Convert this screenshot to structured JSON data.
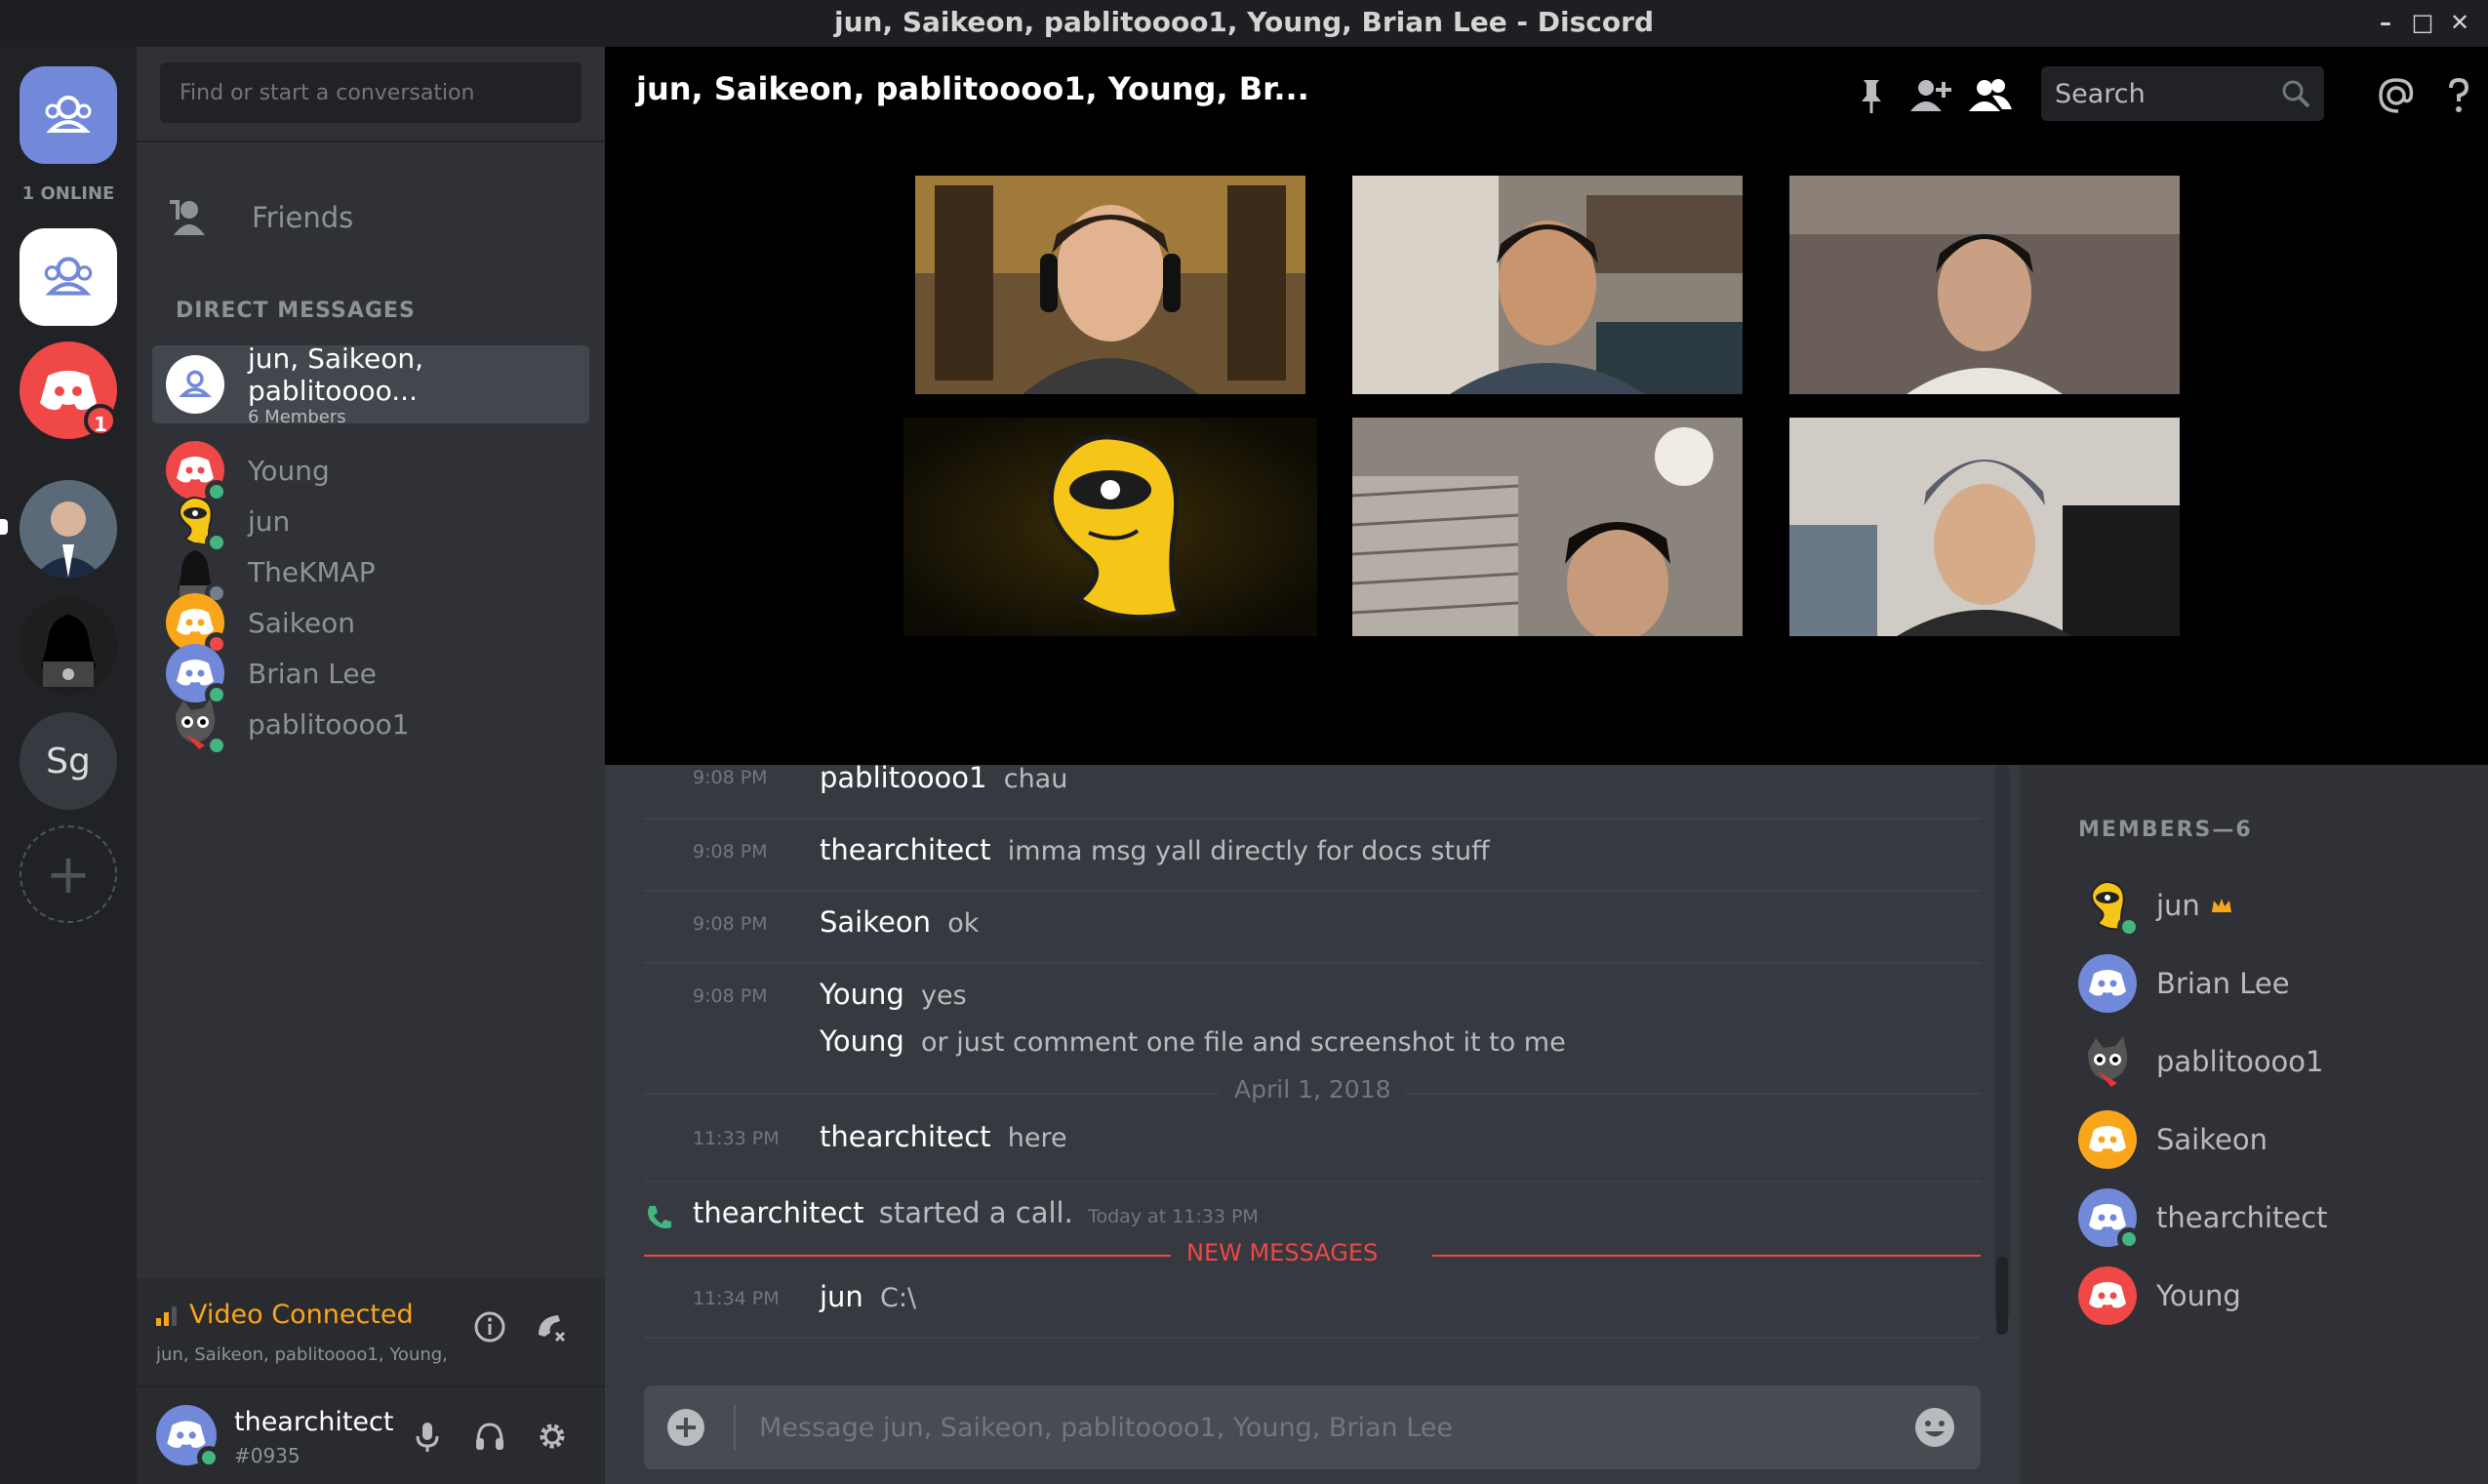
{
  "window": {
    "title": "jun, Saikeon, pablitoooo1, Young, Brian Lee - Discord"
  },
  "rail": {
    "online_label": "1 ONLINE",
    "notification_count": "1",
    "server_initials": "Sg"
  },
  "dm_sidebar": {
    "search_placeholder": "Find or start a conversation",
    "friends_label": "Friends",
    "section_header": "DIRECT MESSAGES",
    "items": [
      {
        "name": "jun, Saikeon, pablitoooo...",
        "sub": "6 Members",
        "selected": true
      },
      {
        "name": "Young",
        "status": "online"
      },
      {
        "name": "jun",
        "status": "online"
      },
      {
        "name": "TheKMAP",
        "status": "offline"
      },
      {
        "name": "Saikeon",
        "status": "dnd"
      },
      {
        "name": "Brian Lee",
        "status": "online"
      },
      {
        "name": "pablitoooo1",
        "status": "online"
      }
    ]
  },
  "voice": {
    "status": "Video Connected",
    "channel": "jun, Saikeon, pablitoooo1, Young, ..."
  },
  "user": {
    "name": "thearchitect",
    "tag": "#0935"
  },
  "header": {
    "channel_name": "jun, Saikeon, pablitoooo1, Young, Br...",
    "search_placeholder": "Search"
  },
  "messages": [
    {
      "time": "9:08 PM",
      "author": "pablitoooo1",
      "text": "chau"
    },
    {
      "time": "9:08 PM",
      "author": "thearchitect",
      "text": "imma msg yall directly for docs stuff"
    },
    {
      "time": "9:08 PM",
      "author": "Saikeon",
      "text": "ok"
    },
    {
      "time": "9:08 PM",
      "author": "Young",
      "text": "yes"
    },
    {
      "time": "",
      "author": "Young",
      "text": "or just comment one file and screenshot it to me"
    },
    {
      "time": "11:33 PM",
      "author": "thearchitect",
      "text": "here"
    },
    {
      "time": "11:34 PM",
      "author": "jun",
      "text": "C:\\"
    }
  ],
  "date_divider": "April 1, 2018",
  "call_event": {
    "author": "thearchitect",
    "text": "started a call.",
    "time": "Today at 11:33 PM"
  },
  "new_messages_label": "NEW MESSAGES",
  "composer": {
    "placeholder": "Message jun, Saikeon, pablitoooo1, Young, Brian Lee"
  },
  "members": {
    "header": "MEMBERS—6",
    "list": [
      {
        "name": "jun",
        "owner": true,
        "status": "online"
      },
      {
        "name": "Brian Lee"
      },
      {
        "name": "pablitoooo1"
      },
      {
        "name": "Saikeon"
      },
      {
        "name": "thearchitect",
        "status": "online"
      },
      {
        "name": "Young"
      }
    ]
  },
  "colors": {
    "blurple": "#7289da",
    "red": "#f04747",
    "orange": "#faa61a",
    "green": "#43b581",
    "yellow": "#f5c518"
  }
}
